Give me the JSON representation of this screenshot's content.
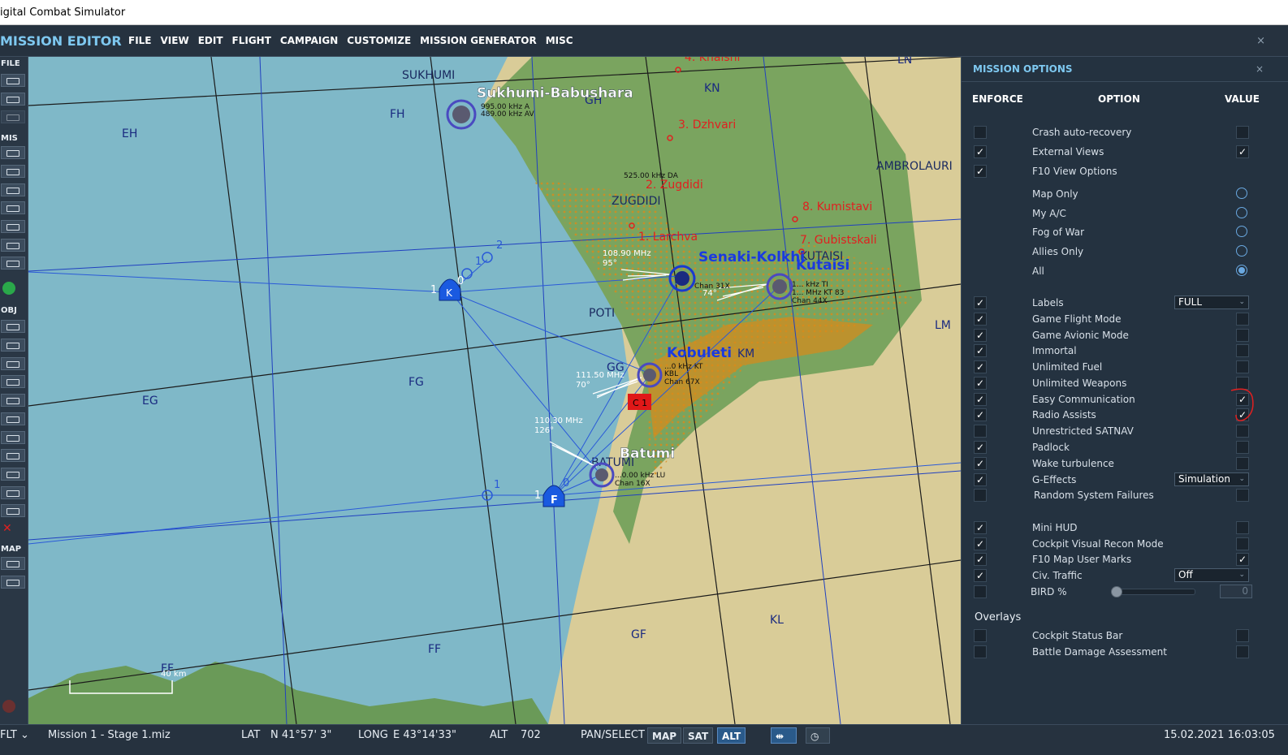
{
  "window": {
    "title": "igital Combat Simulator"
  },
  "menubar": {
    "brand": "MISSION EDITOR",
    "items": [
      "FILE",
      "VIEW",
      "EDIT",
      "FLIGHT",
      "CAMPAIGN",
      "CUSTOMIZE",
      "MISSION GENERATOR",
      "MISC"
    ],
    "close": "×"
  },
  "toolbar": {
    "sections": [
      "FILE",
      "MIS",
      "OBJ",
      "MAP"
    ]
  },
  "map": {
    "grid_labels": [
      "EH",
      "FH",
      "GH",
      "KN",
      "LN",
      "EG",
      "FG",
      "GG",
      "KM",
      "LM",
      "FF",
      "GF",
      "KL",
      "FF"
    ],
    "places_dark": [
      "SUKHUMI",
      "ZUGDIDI",
      "POTI",
      "BATUMI",
      "AMBROLAURI",
      "KUTAISI"
    ],
    "places_red": [
      "4. Khaishi",
      "3. Dzhvari",
      "2. Zugdidi",
      "1. Larchva",
      "8. Kumistavi",
      "7. Gubistskali"
    ],
    "airfields": [
      "Sukhumi-Babushara",
      "Senaki-Kolkhi",
      "Kutaisi",
      "Kobuleti",
      "Batumi"
    ],
    "nav_info": [
      "995.00 kHz A",
      "489.00 kHz AV",
      "525.00 kHz DA",
      "108.90 MHz",
      "95°",
      "Chan 31X",
      "74°",
      "1... kHz TI",
      "1... MHz KT 83",
      "Chan 44X",
      "...0 kHz KT",
      "KBL",
      "Chan 67X",
      "111.50 MHz",
      "70°",
      "110.30 MHz",
      "126°",
      "...0.00 kHz LU",
      "Chan 16X"
    ],
    "waypoint_numbers": [
      "1",
      "2",
      "1",
      "0",
      "1",
      "1",
      "0"
    ],
    "unit_letters": [
      "K",
      "F"
    ],
    "target_label": "C 1",
    "scale": "40 km"
  },
  "panel": {
    "title": "MISSION OPTIONS",
    "close": "×",
    "headers": {
      "enforce": "ENFORCE",
      "option": "OPTION",
      "value": "VALUE"
    },
    "rows": [
      {
        "label": "Crash auto-recovery",
        "enforce": "",
        "value": ""
      },
      {
        "label": "External Views",
        "enforce": "✓",
        "value": "✓"
      },
      {
        "label": "F10 View Options",
        "enforce": "✓",
        "value": ""
      },
      {
        "label": "Map Only",
        "radio": false
      },
      {
        "label": "My A/C",
        "radio": false
      },
      {
        "label": "Fog of War",
        "radio": false
      },
      {
        "label": "Allies Only",
        "radio": false
      },
      {
        "label": "All",
        "radio": true
      },
      {
        "label": "Labels",
        "enforce": "✓",
        "select": "FULL"
      },
      {
        "label": "Game Flight Mode",
        "enforce": "✓",
        "value": ""
      },
      {
        "label": "Game Avionic Mode",
        "enforce": "✓",
        "value": ""
      },
      {
        "label": "Immortal",
        "enforce": "✓",
        "value": ""
      },
      {
        "label": "Unlimited Fuel",
        "enforce": "✓",
        "value": ""
      },
      {
        "label": "Unlimited Weapons",
        "enforce": "✓",
        "value": ""
      },
      {
        "label": "Easy Communication",
        "enforce": "✓",
        "value": "✓"
      },
      {
        "label": "Radio Assists",
        "enforce": "✓",
        "value": "✓"
      },
      {
        "label": "Unrestricted SATNAV",
        "enforce": "",
        "value": ""
      },
      {
        "label": "Padlock",
        "enforce": "✓",
        "value": ""
      },
      {
        "label": "Wake turbulence",
        "enforce": "✓",
        "value": ""
      },
      {
        "label": "G-Effects",
        "enforce": "✓",
        "select": "Simulation"
      },
      {
        "label": "Random System Failures",
        "enforce": "",
        "value": ""
      },
      {
        "label": "Mini HUD",
        "enforce": "✓",
        "value": ""
      },
      {
        "label": "Cockpit Visual Recon Mode",
        "enforce": "✓",
        "value": ""
      },
      {
        "label": "F10 Map User Marks",
        "enforce": "✓",
        "value": "✓"
      },
      {
        "label": "Civ. Traffic",
        "enforce": "✓",
        "select": "Off"
      },
      {
        "label": "BIRD %",
        "enforce": "",
        "slider": 0,
        "number": "0"
      }
    ],
    "overlays_title": "Overlays",
    "overlays": [
      {
        "label": "Cockpit Status Bar",
        "enforce": "",
        "value": ""
      },
      {
        "label": "Battle Damage Assessment",
        "enforce": "",
        "value": ""
      }
    ]
  },
  "statusbar": {
    "mode": "FLT",
    "mission": "Mission 1 - Stage 1.miz",
    "lat_label": "LAT",
    "lat": "N 41°57' 3\"",
    "long_label": "LONG",
    "long": "E 43°14'33\"",
    "alt_label": "ALT",
    "alt": "702",
    "pan": "PAN/SELECT",
    "map_btn": "MAP",
    "sat_btn": "SAT",
    "alt_btn": "ALT",
    "datetime": "15.02.2021 16:03:05"
  },
  "colors": {
    "sea": "#7fb8c8",
    "land_green": "#6a9a58",
    "land_yellow": "#d6c890",
    "orange": "#d98a1a",
    "grid_black": "#1a1a1a",
    "grid_blue": "#2040c0",
    "route_blue": "#2a5ad8",
    "accent": "#7ec8f0"
  }
}
